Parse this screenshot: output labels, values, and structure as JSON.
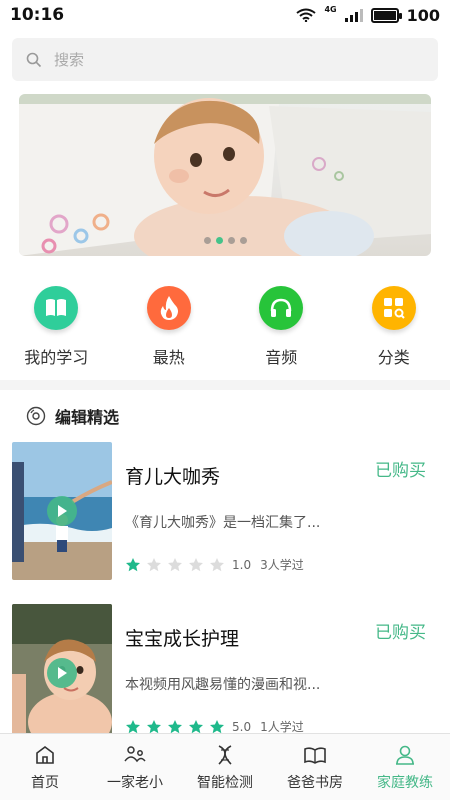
{
  "status_bar": {
    "time": "10:16",
    "network": "4G",
    "battery": 100,
    "battery_label": "100"
  },
  "search": {
    "placeholder": "搜索"
  },
  "banner": {
    "slide_count": 4,
    "active_slide": 2
  },
  "categories": [
    {
      "label": "我的学习",
      "icon": "book-icon",
      "color": "#2fce9a"
    },
    {
      "label": "最热",
      "icon": "flame-icon",
      "color": "#ff6a3d"
    },
    {
      "label": "音频",
      "icon": "headphones-icon",
      "color": "#27c43a"
    },
    {
      "label": "分类",
      "icon": "grid-search-icon",
      "color": "#ffb400"
    }
  ],
  "section": {
    "title": "编辑精选",
    "icon": "disc-icon"
  },
  "items": [
    {
      "title": "育儿大咖秀",
      "status": "已购买",
      "desc": "《育儿大咖秀》是一档汇集了...",
      "stars": 1,
      "rating": "1.0",
      "learners": "3人学过"
    },
    {
      "title": "宝宝成长护理",
      "status": "已购买",
      "desc": "本视频用风趣易懂的漫画和视...",
      "stars": 5,
      "rating": "5.0",
      "learners": "1人学过"
    }
  ],
  "tabbar": [
    {
      "label": "首页",
      "icon": "home-icon",
      "active": false
    },
    {
      "label": "一家老小",
      "icon": "family-icon",
      "active": false
    },
    {
      "label": "智能检测",
      "icon": "dna-icon",
      "active": false
    },
    {
      "label": "爸爸书房",
      "icon": "open-book-icon",
      "active": false
    },
    {
      "label": "家庭教练",
      "icon": "person-icon",
      "active": true
    }
  ],
  "colors": {
    "accent": "#45b888",
    "star_on": "#1fb98b",
    "star_off": "#dcdcdc"
  }
}
